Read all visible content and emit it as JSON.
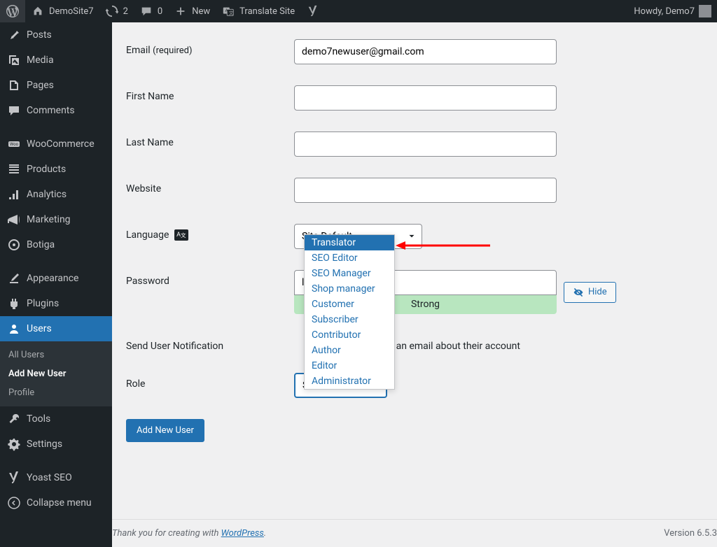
{
  "adminbar": {
    "site_name": "DemoSite7",
    "updates_count": "2",
    "comments_count": "0",
    "new_label": "New",
    "translate_label": "Translate Site",
    "howdy": "Howdy, Demo7"
  },
  "sidebar": {
    "posts": "Posts",
    "media": "Media",
    "pages": "Pages",
    "comments": "Comments",
    "woocommerce": "WooCommerce",
    "products": "Products",
    "analytics": "Analytics",
    "marketing": "Marketing",
    "botiga": "Botiga",
    "appearance": "Appearance",
    "plugins": "Plugins",
    "users": "Users",
    "submenu": {
      "all_users": "All Users",
      "add_new": "Add New User",
      "profile": "Profile"
    },
    "tools": "Tools",
    "settings": "Settings",
    "yoast": "Yoast SEO",
    "collapse": "Collapse menu"
  },
  "form": {
    "email_label": "Email",
    "email_req": "(required)",
    "email_value": "demo7newuser@gmail.com",
    "first_name_label": "First Name",
    "last_name_label": "Last Name",
    "website_label": "Website",
    "language_label": "Language",
    "language_value": "Site Default",
    "password_label": "Password",
    "password_value": "lamb9(rluK",
    "password_strength": "Strong",
    "hide_btn": "Hide",
    "notification_label": "Send User Notification",
    "notification_desc": "er an email about their account",
    "role_label": "Role",
    "role_value": "Subscriber",
    "submit": "Add New User"
  },
  "dropdown": {
    "options": [
      "Translator",
      "SEO Editor",
      "SEO Manager",
      "Shop manager",
      "Customer",
      "Subscriber",
      "Contributor",
      "Author",
      "Editor",
      "Administrator"
    ]
  },
  "footer": {
    "thanks_prefix": "Thank you for creating with ",
    "wp_link": "WordPress",
    "thanks_suffix": ".",
    "version": "Version 6.5.3"
  }
}
